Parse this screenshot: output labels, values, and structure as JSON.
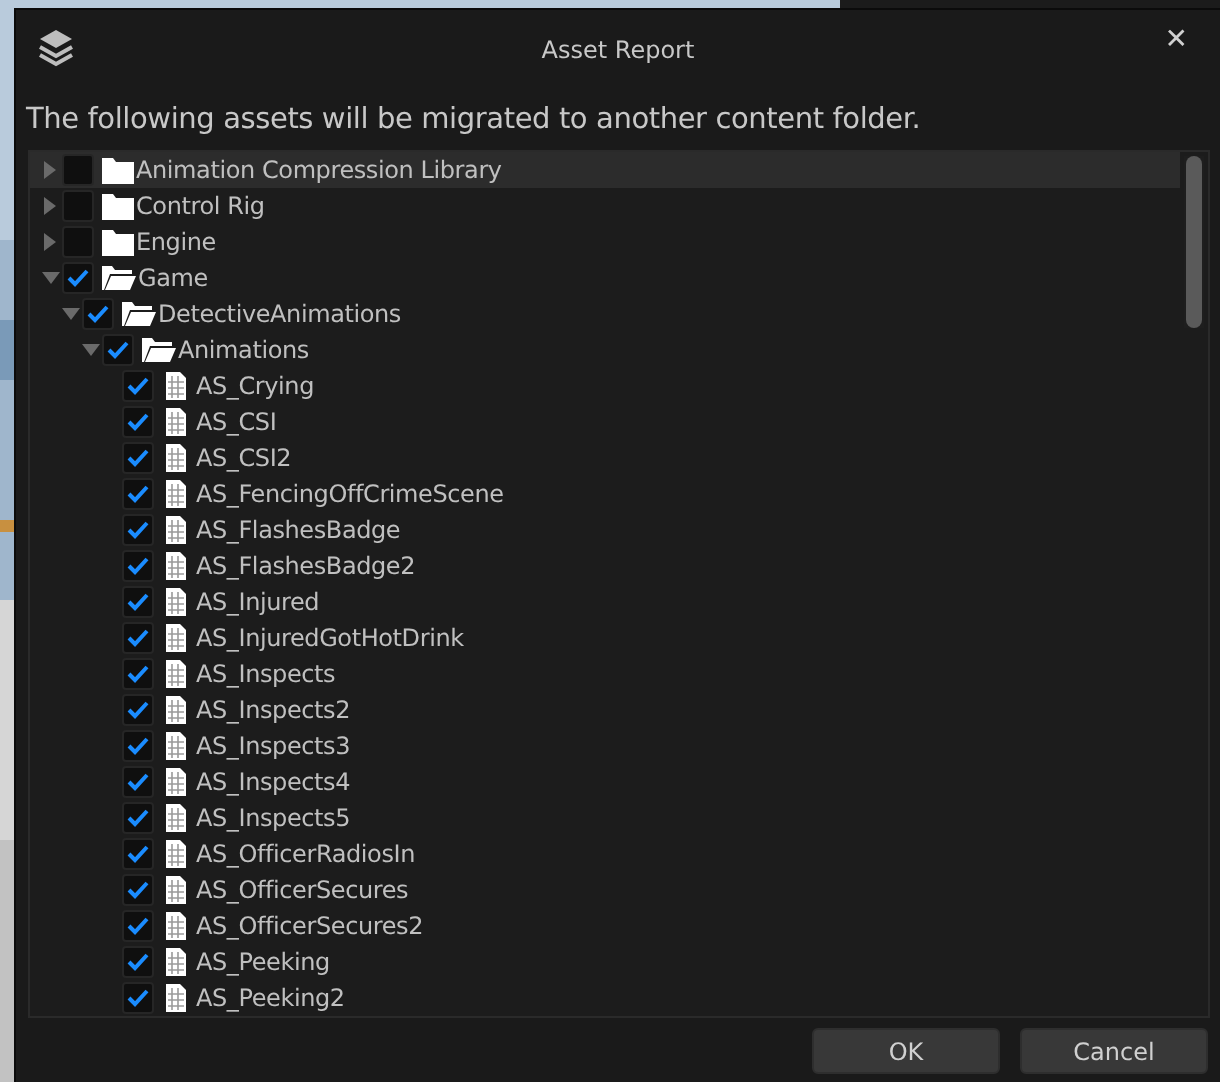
{
  "window": {
    "title": "Asset Report",
    "close": "✕"
  },
  "message": "The following assets will be migrated to another content folder.",
  "tree": [
    {
      "label": "Animation Compression Library",
      "kind": "folder",
      "expanded": false,
      "checked": false,
      "selected": true
    },
    {
      "label": "Control Rig",
      "kind": "folder",
      "expanded": false,
      "checked": false,
      "selected": false
    },
    {
      "label": "Engine",
      "kind": "folder",
      "expanded": false,
      "checked": false,
      "selected": false
    },
    {
      "label": "Game",
      "kind": "folder",
      "expanded": true,
      "checked": true,
      "selected": false,
      "children": [
        {
          "label": "DetectiveAnimations",
          "kind": "folder",
          "expanded": true,
          "checked": true,
          "selected": false,
          "children": [
            {
              "label": "Animations",
              "kind": "folder",
              "expanded": true,
              "checked": true,
              "selected": false,
              "children": [
                {
                  "label": "AS_Crying",
                  "kind": "asset",
                  "checked": true,
                  "selected": false
                },
                {
                  "label": "AS_CSI",
                  "kind": "asset",
                  "checked": true,
                  "selected": false
                },
                {
                  "label": "AS_CSI2",
                  "kind": "asset",
                  "checked": true,
                  "selected": false
                },
                {
                  "label": "AS_FencingOffCrimeScene",
                  "kind": "asset",
                  "checked": true,
                  "selected": false
                },
                {
                  "label": "AS_FlashesBadge",
                  "kind": "asset",
                  "checked": true,
                  "selected": false
                },
                {
                  "label": "AS_FlashesBadge2",
                  "kind": "asset",
                  "checked": true,
                  "selected": false
                },
                {
                  "label": "AS_Injured",
                  "kind": "asset",
                  "checked": true,
                  "selected": false
                },
                {
                  "label": "AS_InjuredGotHotDrink",
                  "kind": "asset",
                  "checked": true,
                  "selected": false
                },
                {
                  "label": "AS_Inspects",
                  "kind": "asset",
                  "checked": true,
                  "selected": false
                },
                {
                  "label": "AS_Inspects2",
                  "kind": "asset",
                  "checked": true,
                  "selected": false
                },
                {
                  "label": "AS_Inspects3",
                  "kind": "asset",
                  "checked": true,
                  "selected": false
                },
                {
                  "label": "AS_Inspects4",
                  "kind": "asset",
                  "checked": true,
                  "selected": false
                },
                {
                  "label": "AS_Inspects5",
                  "kind": "asset",
                  "checked": true,
                  "selected": false
                },
                {
                  "label": "AS_OfficerRadiosIn",
                  "kind": "asset",
                  "checked": true,
                  "selected": false
                },
                {
                  "label": "AS_OfficerSecures",
                  "kind": "asset",
                  "checked": true,
                  "selected": false
                },
                {
                  "label": "AS_OfficerSecures2",
                  "kind": "asset",
                  "checked": true,
                  "selected": false
                },
                {
                  "label": "AS_Peeking",
                  "kind": "asset",
                  "checked": true,
                  "selected": false
                },
                {
                  "label": "AS_Peeking2",
                  "kind": "asset",
                  "checked": true,
                  "selected": false
                }
              ]
            }
          ]
        }
      ]
    }
  ],
  "buttons": [
    "OK",
    "Cancel"
  ]
}
